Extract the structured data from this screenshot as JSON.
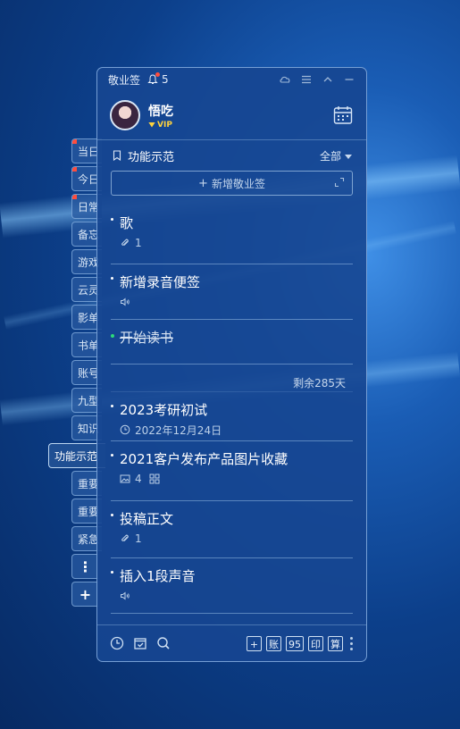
{
  "app": {
    "title": "敬业签",
    "notification_count": "5"
  },
  "user": {
    "name": "悟吃",
    "badge": "VIP"
  },
  "category": {
    "name": "功能示范",
    "filter": "全部"
  },
  "new_button": {
    "plus": "+",
    "label": "新增敬业签"
  },
  "notes": [
    {
      "title": "歌",
      "meta_icon": "paperclip-icon",
      "meta": "1"
    },
    {
      "title": "新增录音便签",
      "meta_icon": "speaker-icon",
      "meta": ""
    },
    {
      "title": "开始读书",
      "status": "done",
      "remaining": "剩余285天"
    },
    {
      "title": "2023考研初试",
      "meta_icon": "clock-icon",
      "meta": "2022年12月24日"
    },
    {
      "title": "2021客户发布产品图片收藏",
      "meta_icon": "image-icon",
      "meta": "4"
    },
    {
      "title": "投稿正文",
      "meta_icon": "paperclip-icon",
      "meta": "1"
    },
    {
      "title": "插入1段声音",
      "meta_icon": "speaker-icon",
      "meta": ""
    }
  ],
  "side_tabs": [
    {
      "label": "当日",
      "marked": true
    },
    {
      "label": "今日",
      "marked": true
    },
    {
      "label": "日常",
      "marked": true
    },
    {
      "label": "备忘",
      "marked": false
    },
    {
      "label": "游戏",
      "marked": false
    },
    {
      "label": "云灵",
      "marked": false
    },
    {
      "label": "影单",
      "marked": false
    },
    {
      "label": "书单",
      "marked": false
    },
    {
      "label": "账号",
      "marked": false
    },
    {
      "label": "九型",
      "marked": false
    },
    {
      "label": "知识",
      "marked": false
    },
    {
      "label": "功能示范",
      "active": true
    },
    {
      "label": "重要",
      "marked": false
    },
    {
      "label": "重要",
      "marked": false
    },
    {
      "label": "紧急",
      "marked": false
    }
  ],
  "side_tab_more": "⋮",
  "side_tab_add": "+",
  "toolbar": {
    "add": "+",
    "account": "账",
    "code": "95",
    "print": "印",
    "calc": "算"
  },
  "colors": {
    "panel": "#16468f",
    "accent_red": "#ff4d3d",
    "done_green": "#2ddc7a",
    "vip_gold": "#ffd33d"
  }
}
